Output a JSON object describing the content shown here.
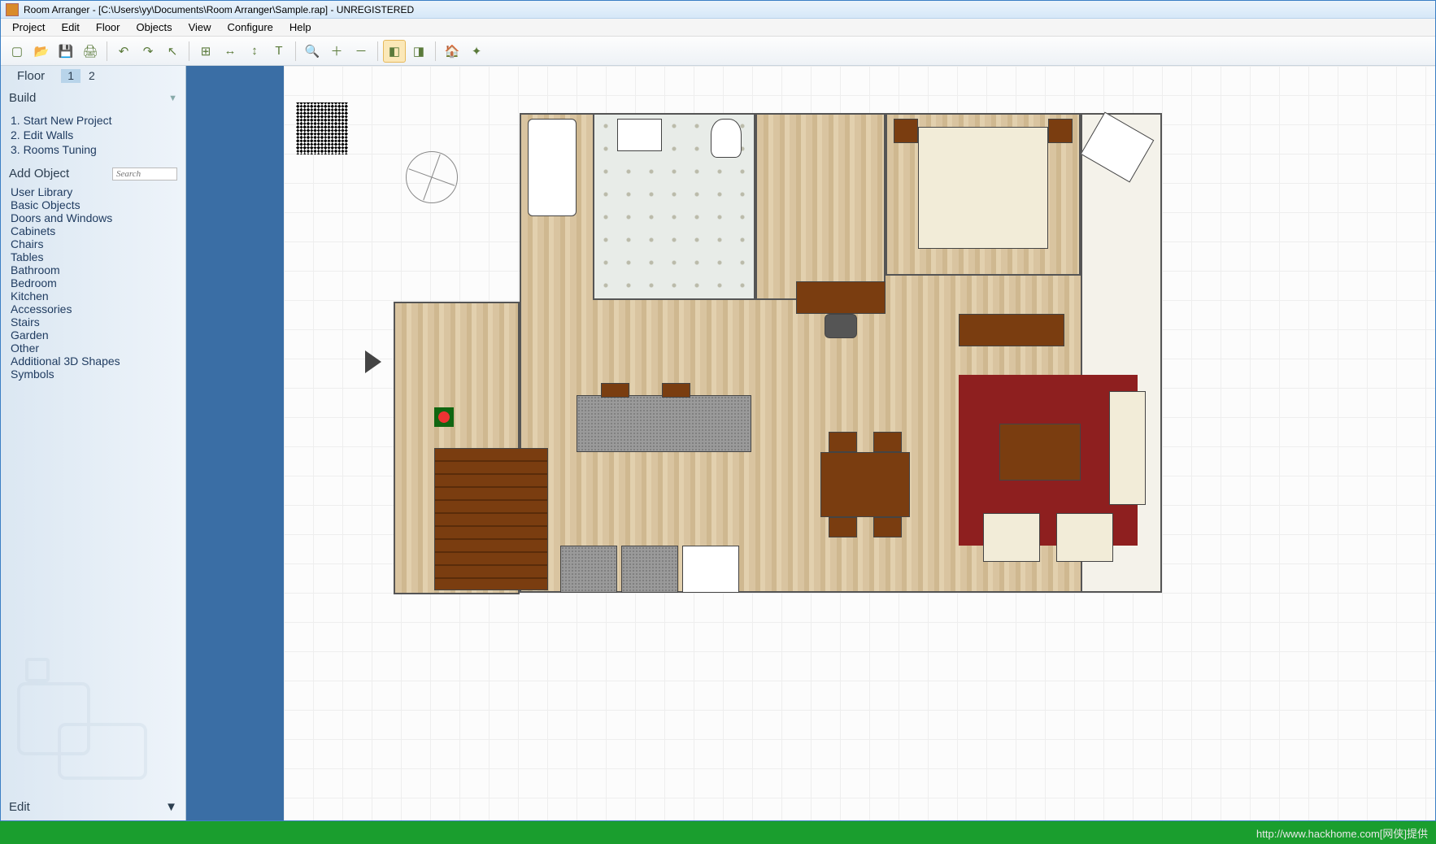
{
  "title": "Room Arranger - [C:\\Users\\yy\\Documents\\Room Arranger\\Sample.rap] - UNREGISTERED",
  "menu": [
    "Project",
    "Edit",
    "Floor",
    "Objects",
    "View",
    "Configure",
    "Help"
  ],
  "toolbar": {
    "icons": [
      "new",
      "open",
      "save",
      "print",
      "undo",
      "redo",
      "select",
      "walls",
      "measure",
      "dimension",
      "text",
      "zoom-fit",
      "zoom-in",
      "zoom-out",
      "view3d",
      "view3d-walk",
      "home",
      "cursor-anim"
    ],
    "active": "view3d"
  },
  "sidebar": {
    "floor_label": "Floor",
    "floors": [
      "1",
      "2"
    ],
    "active_floor": "1",
    "build_header": "Build",
    "build_items": [
      "1. Start New Project",
      "2. Edit Walls",
      "3. Rooms Tuning"
    ],
    "addobj_header": "Add Object",
    "search_placeholder": "Search",
    "object_categories": [
      "User Library",
      "Basic Objects",
      "Doors and Windows",
      "Cabinets",
      "Chairs",
      "Tables",
      "Bathroom",
      "Bedroom",
      "Kitchen",
      "Accessories",
      "Stairs",
      "Garden",
      "Other",
      "Additional 3D Shapes",
      "Symbols"
    ],
    "edit_header": "Edit"
  },
  "footer": "http://www.hackhome.com[网侠]提供"
}
